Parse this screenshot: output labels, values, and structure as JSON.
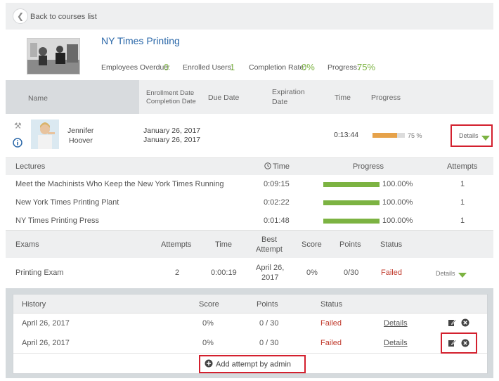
{
  "nav": {
    "back_label": "Back to courses list"
  },
  "course": {
    "title": "NY Times Printing",
    "stats": {
      "overdue_label": "Employees Overdue:",
      "overdue_value": "0",
      "enrolled_label": "Enrolled Users:",
      "enrolled_value": "1",
      "completion_label": "Completion Rate:",
      "completion_value": "0%",
      "progress_label": "Progress:",
      "progress_value": "75%"
    }
  },
  "users_table": {
    "headers": {
      "name": "Name",
      "enroll_line1": "Enrollment Date",
      "enroll_line2": "Completion Date",
      "due": "Due Date",
      "exp_line1": "Expiration",
      "exp_line2": "Date",
      "time": "Time",
      "progress": "Progress"
    },
    "row": {
      "first_name": "Jennifer",
      "last_name": "Hoover",
      "enrollment_date": "January 26, 2017",
      "completion_date": "January 26, 2017",
      "time": "0:13:44",
      "progress_percent": 75,
      "progress_text": "75 %",
      "details_label": "Details"
    }
  },
  "lectures": {
    "headers": {
      "name": "Lectures",
      "time": "Time",
      "progress": "Progress",
      "attempts": "Attempts"
    },
    "rows": [
      {
        "name": "Meet the Machinists Who Keep the New York Times Running",
        "time": "0:09:15",
        "progress_percent": 100,
        "progress_text": "100.00%",
        "attempts": "1"
      },
      {
        "name": "New York Times Printing Plant",
        "time": "0:02:22",
        "progress_percent": 100,
        "progress_text": "100.00%",
        "attempts": "1"
      },
      {
        "name": "NY Times Printing Press",
        "time": "0:01:48",
        "progress_percent": 100,
        "progress_text": "100.00%",
        "attempts": "1"
      }
    ]
  },
  "exams": {
    "headers": {
      "name": "Exams",
      "attempts": "Attempts",
      "time": "Time",
      "best_line1": "Best",
      "best_line2": "Attempt",
      "score": "Score",
      "points": "Points",
      "status": "Status"
    },
    "rows": [
      {
        "name": "Printing Exam",
        "attempts": "2",
        "time": "0:00:19",
        "best_line1": "April 26,",
        "best_line2": "2017",
        "score": "0%",
        "points": "0/30",
        "status": "Failed",
        "details_label": "Details"
      }
    ]
  },
  "history": {
    "headers": {
      "name": "History",
      "score": "Score",
      "points": "Points",
      "status": "Status"
    },
    "rows": [
      {
        "date": "April 26, 2017",
        "score": "0%",
        "points": "0 / 30",
        "status": "Failed",
        "details_label": "Details"
      },
      {
        "date": "April 26, 2017",
        "score": "0%",
        "points": "0 / 30",
        "status": "Failed",
        "details_label": "Details"
      }
    ],
    "add_attempt_label": "Add attempt by admin"
  },
  "colors": {
    "link": "#2a67a8",
    "accent_green": "#7cb342",
    "failed_red": "#c0392b",
    "highlight_red": "#d3202e",
    "user_progress_orange": "#e6a24a"
  }
}
